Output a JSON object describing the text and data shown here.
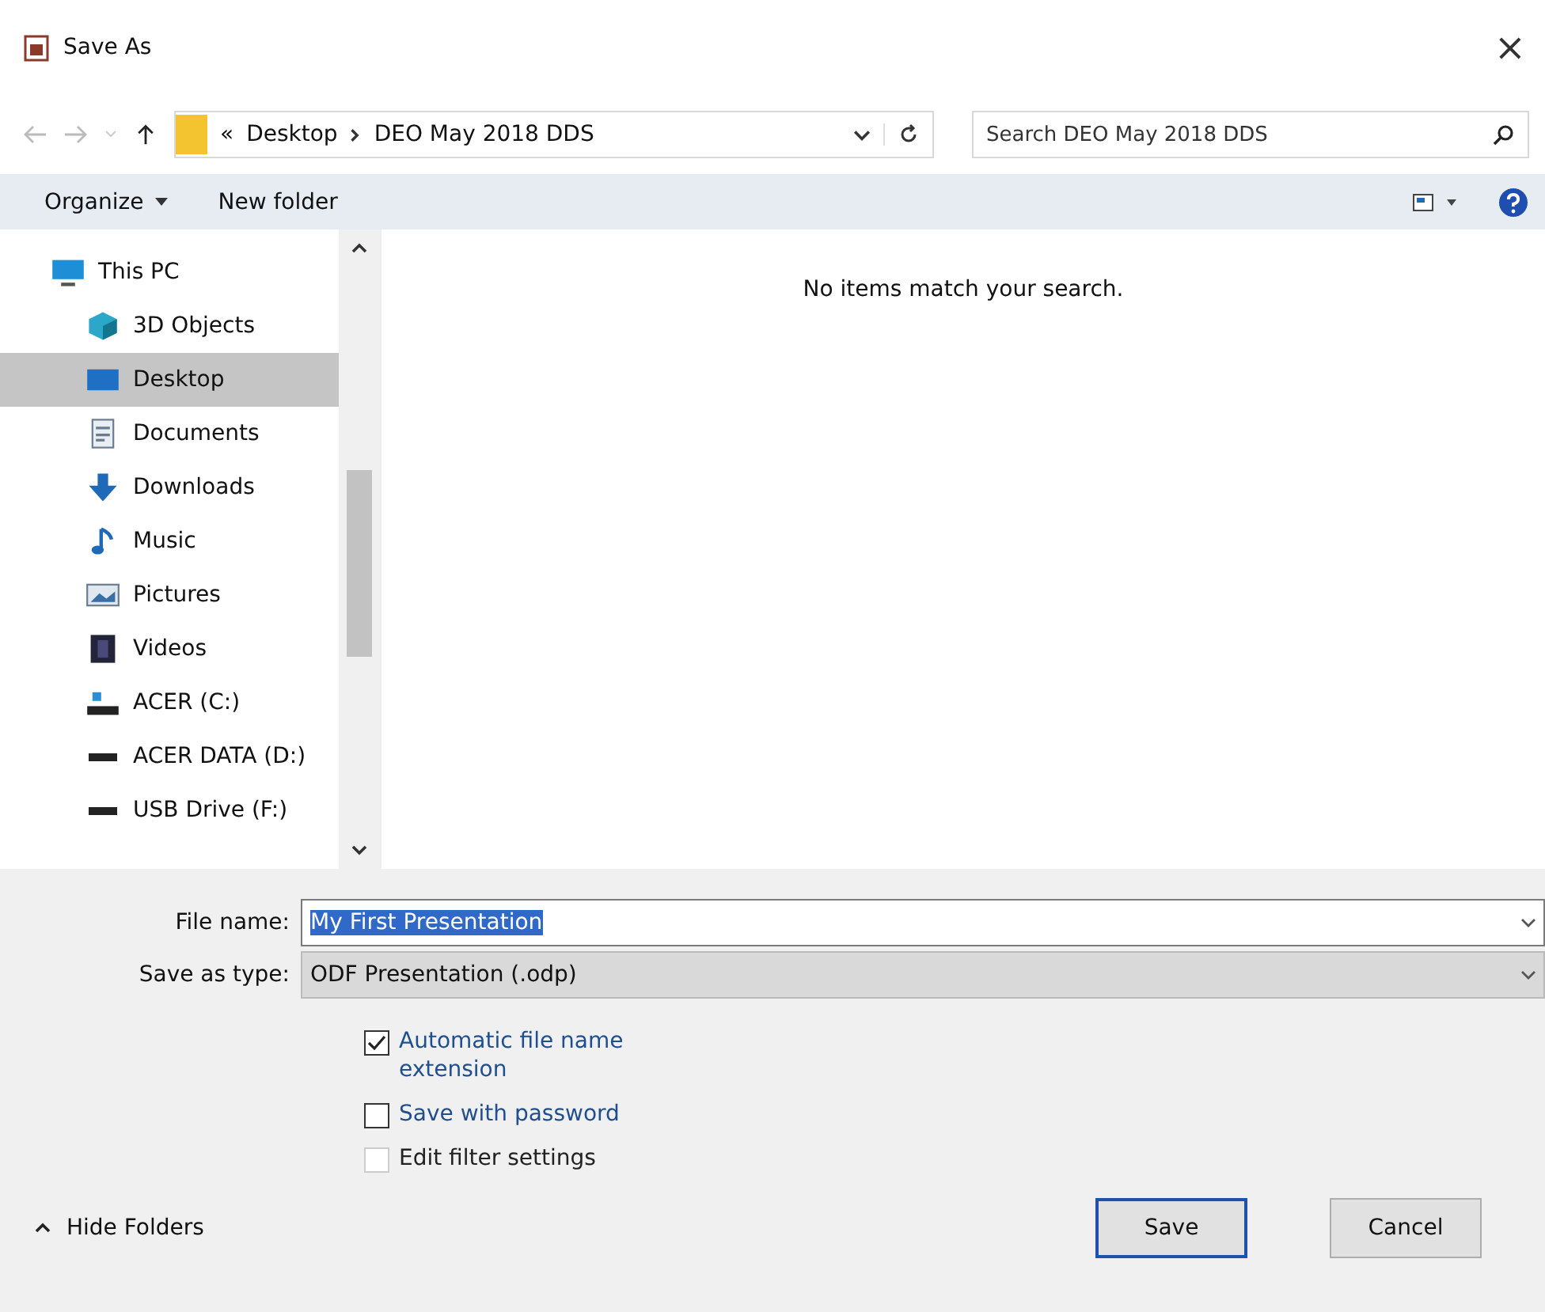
{
  "window": {
    "title": "Save As",
    "close": "×"
  },
  "address": {
    "overflow": "«",
    "path": [
      "Desktop",
      "DEO May 2018 DDS"
    ]
  },
  "search": {
    "placeholder": "Search DEO May 2018 DDS"
  },
  "toolbar": {
    "organize": "Organize",
    "new_folder": "New folder"
  },
  "sidebar": {
    "items": [
      {
        "label": "This PC",
        "kind": "pc",
        "selected": false,
        "children": [
          {
            "label": "3D Objects",
            "kind": "objects",
            "selected": false
          },
          {
            "label": "Desktop",
            "kind": "desktop",
            "selected": true
          },
          {
            "label": "Documents",
            "kind": "documents",
            "selected": false
          },
          {
            "label": "Downloads",
            "kind": "downloads",
            "selected": false
          },
          {
            "label": "Music",
            "kind": "music",
            "selected": false
          },
          {
            "label": "Pictures",
            "kind": "pictures",
            "selected": false
          },
          {
            "label": "Videos",
            "kind": "videos",
            "selected": false
          },
          {
            "label": "ACER (C:)",
            "kind": "system-drive",
            "selected": false
          },
          {
            "label": "ACER DATA (D:)",
            "kind": "drive",
            "selected": false
          },
          {
            "label": "USB Drive (F:)",
            "kind": "drive",
            "selected": false
          }
        ]
      }
    ]
  },
  "content": {
    "empty_message": "No items match your search."
  },
  "file_name": {
    "label": "File name:",
    "value": "My First Presentation"
  },
  "save_as_type": {
    "label": "Save as type:",
    "value": "ODF Presentation (.odp)"
  },
  "options": [
    {
      "label": "Automatic file name extension",
      "checked": true,
      "disabled": false
    },
    {
      "label": "Save with password",
      "checked": false,
      "disabled": false
    },
    {
      "label": "Edit filter settings",
      "checked": false,
      "disabled": true
    }
  ],
  "hide_folders": "Hide Folders",
  "buttons": [
    {
      "label": "Save",
      "default": true
    },
    {
      "label": "Cancel",
      "default": false
    }
  ]
}
